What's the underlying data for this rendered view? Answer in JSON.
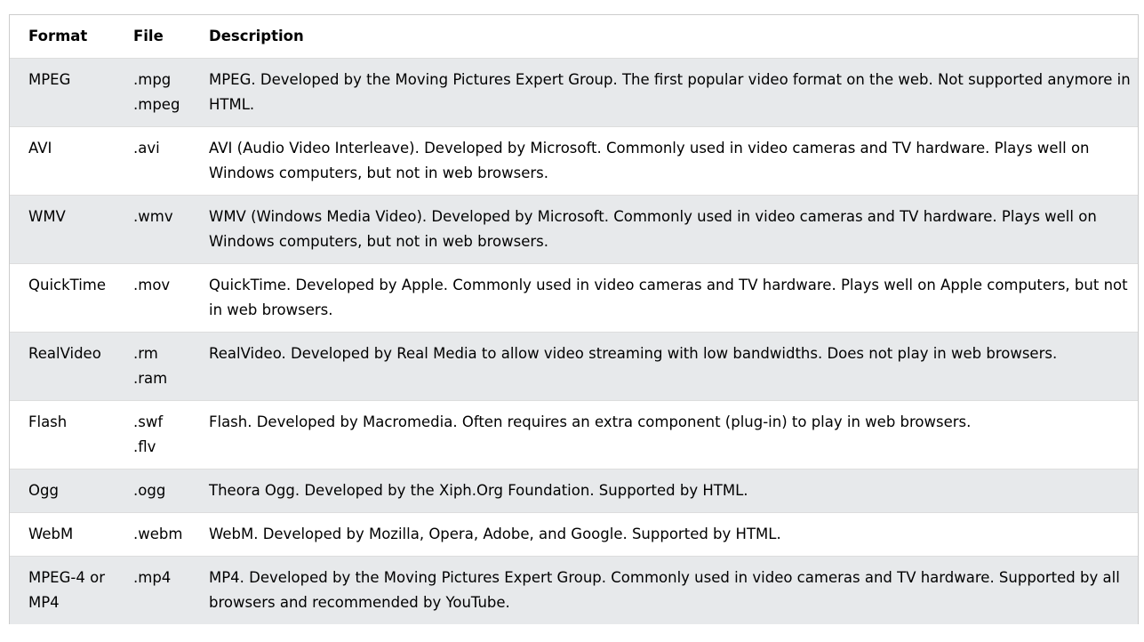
{
  "headers": {
    "format": "Format",
    "file": "File",
    "description": "Description"
  },
  "rows": [
    {
      "format": "MPEG",
      "files": [
        ".mpg",
        ".mpeg"
      ],
      "description": "MPEG. Developed by the Moving Pictures Expert Group. The first popular video format on the web. Not supported anymore in HTML."
    },
    {
      "format": "AVI",
      "files": [
        ".avi"
      ],
      "description": "AVI (Audio Video Interleave). Developed by Microsoft. Commonly used in video cameras and TV hardware. Plays well on Windows computers, but not in web browsers."
    },
    {
      "format": "WMV",
      "files": [
        ".wmv"
      ],
      "description": "WMV (Windows Media Video). Developed by Microsoft. Commonly used in video cameras and TV hardware. Plays well on Windows computers, but not in web browsers."
    },
    {
      "format": "QuickTime",
      "files": [
        ".mov"
      ],
      "description": "QuickTime. Developed by Apple. Commonly used in video cameras and TV hardware. Plays well on Apple computers, but not in web browsers."
    },
    {
      "format": "RealVideo",
      "files": [
        ".rm",
        ".ram"
      ],
      "description": "RealVideo. Developed by Real Media to allow video streaming with low bandwidths. Does not play in web browsers."
    },
    {
      "format": "Flash",
      "files": [
        ".swf",
        ".flv"
      ],
      "description": "Flash. Developed by Macromedia. Often requires an extra component (plug-in) to play in web browsers."
    },
    {
      "format": "Ogg",
      "files": [
        ".ogg"
      ],
      "description": "Theora Ogg. Developed by the Xiph.Org Foundation. Supported by HTML."
    },
    {
      "format": "WebM",
      "files": [
        ".webm"
      ],
      "description": "WebM. Developed by Mozilla, Opera, Adobe, and Google. Supported by HTML."
    },
    {
      "format": "MPEG-4 or MP4",
      "files": [
        ".mp4"
      ],
      "description": "MP4. Developed by the Moving Pictures Expert Group. Commonly used in video cameras and TV hardware. Supported by all browsers and  recommended by YouTube."
    }
  ],
  "colors": {
    "shaded_row": "#e7e9eb",
    "plain_row": "#ffffff",
    "border": "#cccccc",
    "text": "#000000"
  }
}
